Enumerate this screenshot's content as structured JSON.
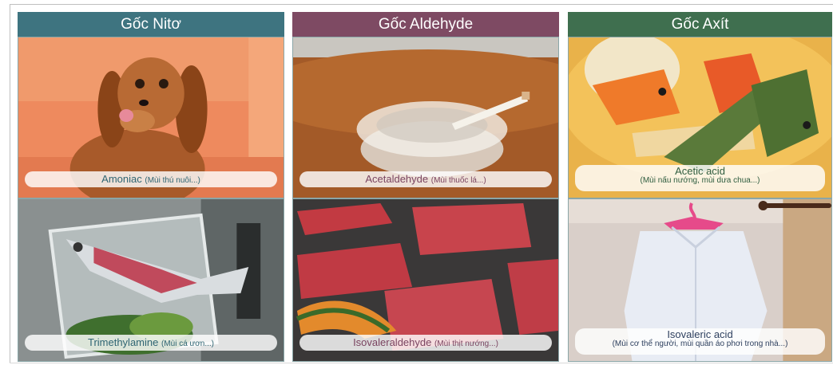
{
  "columns": [
    {
      "header": "Gốc Nitơ",
      "tiles": [
        {
          "image": "dog-photo",
          "title": "Amoniac",
          "subtitle": "(Mùi thú nuôi...)"
        },
        {
          "image": "fish-skeleton-photo",
          "title": "Trimethylamine",
          "subtitle": "(Mùi cá ươn...)"
        }
      ]
    },
    {
      "header": "Gốc Aldehyde",
      "tiles": [
        {
          "image": "ashtray-cigarette-photo",
          "title": "Acetaldehyde",
          "subtitle": "(Mùi thuốc lá...)"
        },
        {
          "image": "grilled-meat-photo",
          "title": "Isovaleraldehyde",
          "subtitle": "(Mùi thịt nướng...)"
        }
      ]
    },
    {
      "header": "Gốc Axít",
      "tiles": [
        {
          "image": "pickled-vegetables-photo",
          "title": "Acetic acid",
          "subtitle": "(Mùi nấu nướng, mùi dưa chua...)"
        },
        {
          "image": "shirt-on-hanger-photo",
          "title": "Isovaleric acid",
          "subtitle": "(Mùi cơ thể người, mùi quần áo phơi trong nhà...)"
        }
      ]
    }
  ]
}
